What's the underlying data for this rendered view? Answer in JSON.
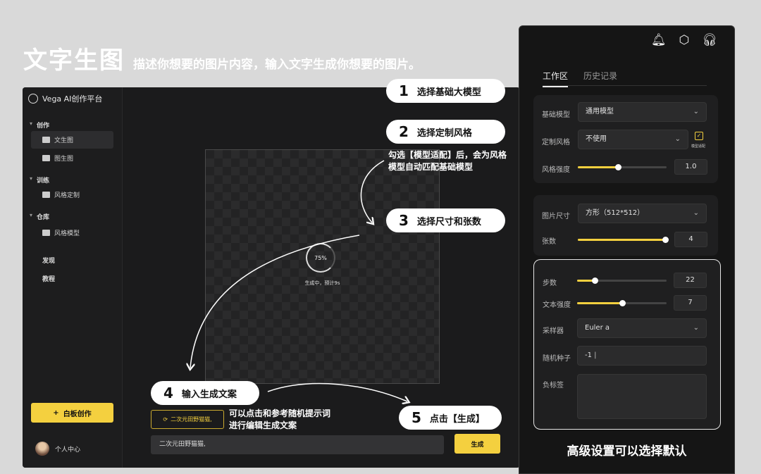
{
  "header": {
    "title": "文字生图",
    "subtitle": "描述你想要的图片内容，输入文字生成你想要的图片。"
  },
  "app": {
    "brand": "Vega AI创作平台",
    "sidebar": {
      "groups": [
        {
          "label": "创作",
          "items": [
            "文生图",
            "图生图"
          ]
        },
        {
          "label": "训练",
          "items": [
            "风格定制"
          ]
        },
        {
          "label": "仓库",
          "items": [
            "风格模型"
          ]
        }
      ],
      "extra": [
        "发现",
        "教程"
      ],
      "new_button": "白板创作",
      "user": "个人中心"
    },
    "canvas": {
      "progress": "75%",
      "progress_value": 0.75,
      "status": "生成中，预计9s"
    },
    "prompt_chip": "二次元田野猫猫,",
    "prompt_value": "二次元田野猫猫,",
    "generate_label": "生成"
  },
  "callouts": {
    "s1": {
      "num": "1",
      "text": "选择基础大模型"
    },
    "s2": {
      "num": "2",
      "text": "选择定制风格"
    },
    "s2_note": [
      "勾选【模型适配】后，会为风格",
      "模型自动匹配基础模型"
    ],
    "s3": {
      "num": "3",
      "text": "选择尺寸和张数"
    },
    "s4": {
      "num": "4",
      "text": "输入生成文案"
    },
    "s4_note": [
      "可以点击和参考随机提示词",
      "进行编辑生成文案"
    ],
    "s5": {
      "num": "5",
      "text": "点击【生成】"
    }
  },
  "panel": {
    "icons": [
      "bell-icon",
      "settings-icon",
      "headset-icon"
    ],
    "tabs": [
      "工作区",
      "历史记录"
    ],
    "base_model": {
      "label": "基础模型",
      "value": "通用模型"
    },
    "style": {
      "label": "定制风格",
      "value": "不使用",
      "check_label": "模型适配",
      "check_mark": "✓"
    },
    "style_strength": {
      "label": "风格强度",
      "value": "1.0",
      "fraction": 0.45
    },
    "size": {
      "label": "图片尺寸",
      "value": "方形（512*512）"
    },
    "count": {
      "label": "张数",
      "value": "4",
      "fraction": 1.0
    },
    "steps": {
      "label": "步数",
      "value": "22",
      "fraction": 0.2
    },
    "cfg": {
      "label": "文本强度",
      "value": "7",
      "fraction": 0.5
    },
    "sampler": {
      "label": "采样器",
      "value": "Euler a"
    },
    "seed": {
      "label": "随机种子",
      "value": "-1"
    },
    "negative": {
      "label": "负标签",
      "value": ""
    },
    "caption": "高级设置可以选择默认"
  },
  "colors": {
    "accent": "#f4d03f",
    "bg": "#1b1b1c",
    "panel": "#151515"
  }
}
